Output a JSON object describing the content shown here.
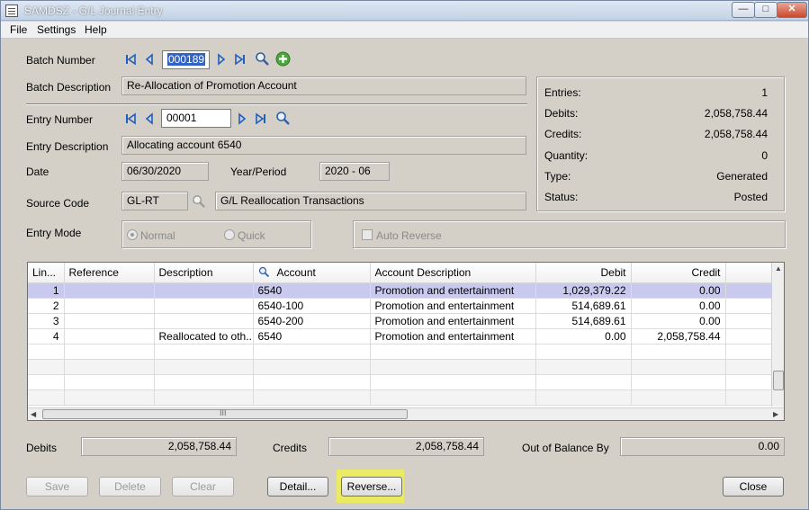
{
  "window": {
    "title": "SAMDSZ - G/L Journal Entry"
  },
  "menu": [
    "File",
    "Settings",
    "Help"
  ],
  "batch": {
    "number_label": "Batch Number",
    "number": "000189",
    "description_label": "Batch Description",
    "description": "Re-Allocation of Promotion Account"
  },
  "entry": {
    "number_label": "Entry Number",
    "number": "00001",
    "description_label": "Entry Description",
    "description": "Allocating account 6540",
    "date_label": "Date",
    "date": "06/30/2020",
    "year_period_label": "Year/Period",
    "year_period": "2020 - 06",
    "source_code_label": "Source Code",
    "source_code": "GL-RT",
    "source_description": "G/L Reallocation Transactions",
    "mode_label": "Entry Mode",
    "mode_normal": "Normal",
    "mode_quick": "Quick",
    "auto_reverse": "Auto Reverse"
  },
  "summary": [
    {
      "label": "Entries:",
      "value": "1"
    },
    {
      "label": "Debits:",
      "value": "2,058,758.44"
    },
    {
      "label": "Credits:",
      "value": "2,058,758.44"
    },
    {
      "label": "Quantity:",
      "value": "0"
    },
    {
      "label": "Type:",
      "value": "Generated"
    },
    {
      "label": "Status:",
      "value": "Posted"
    }
  ],
  "grid": {
    "columns": [
      "Lin...",
      "Reference",
      "Description",
      "Account",
      "Account Description",
      "Debit",
      "Credit"
    ],
    "rows": [
      {
        "line": "1",
        "reference": "",
        "description": "",
        "account": "6540",
        "account_description": "Promotion and entertainment",
        "debit": "1,029,379.22",
        "credit": "0.00"
      },
      {
        "line": "2",
        "reference": "",
        "description": "",
        "account": "6540-100",
        "account_description": "Promotion and entertainment",
        "debit": "514,689.61",
        "credit": "0.00"
      },
      {
        "line": "3",
        "reference": "",
        "description": "",
        "account": "6540-200",
        "account_description": "Promotion and entertainment",
        "debit": "514,689.61",
        "credit": "0.00"
      },
      {
        "line": "4",
        "reference": "",
        "description": "Reallocated to oth...",
        "account": "6540",
        "account_description": "Promotion and entertainment",
        "debit": "0.00",
        "credit": "2,058,758.44"
      }
    ],
    "hscroll_grip": "III"
  },
  "totals": {
    "debits_label": "Debits",
    "debits": "2,058,758.44",
    "credits_label": "Credits",
    "credits": "2,058,758.44",
    "out_of_balance_label": "Out of Balance By",
    "out_of_balance": "0.00"
  },
  "buttons": {
    "save": "Save",
    "delete": "Delete",
    "clear": "Clear",
    "detail": "Detail...",
    "reverse": "Reverse...",
    "close": "Close"
  },
  "colors": {
    "selected_row": "#c9c9f0",
    "highlight": "#f0f04a",
    "selection": "#3163c5"
  }
}
